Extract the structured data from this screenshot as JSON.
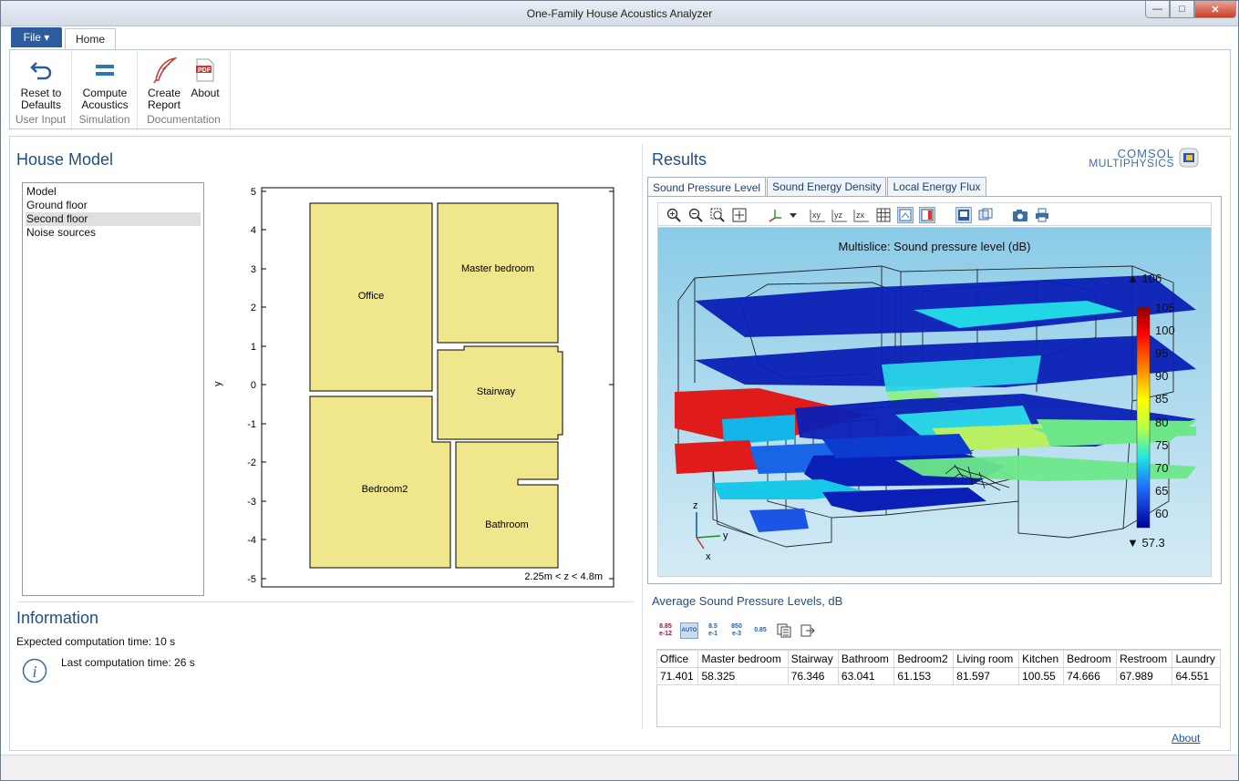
{
  "window": {
    "title": "One-Family House Acoustics Analyzer"
  },
  "ribbon": {
    "file_label": "File ▾",
    "home_label": "Home",
    "groups": [
      {
        "label": "User Input",
        "buttons": [
          {
            "label1": "Reset to",
            "label2": "Defaults",
            "icon": "undo-arrow-icon"
          }
        ]
      },
      {
        "label": "Simulation",
        "buttons": [
          {
            "label1": "Compute",
            "label2": "Acoustics",
            "icon": "equals-icon"
          }
        ]
      },
      {
        "label": "Documentation",
        "buttons": [
          {
            "label1": "Create",
            "label2": "Report",
            "icon": "quill-icon"
          },
          {
            "label1": "About",
            "label2": "",
            "icon": "pdf-icon"
          }
        ]
      }
    ]
  },
  "house_model": {
    "title": "House Model",
    "tree": [
      "Model",
      "Ground floor",
      "Second floor",
      "Noise sources"
    ],
    "selected_index": 2,
    "plot": {
      "y_label": "y",
      "y_ticks": [
        "5",
        "4",
        "3",
        "2",
        "1",
        "0",
        "-1",
        "-2",
        "-3",
        "-4",
        "-5"
      ],
      "rooms": [
        "Office",
        "Master bedroom",
        "Stairway",
        "Bedroom2",
        "Bathroom"
      ],
      "annotation": "2.25m < z < 4.8m",
      "room_color": "#f0e68c"
    }
  },
  "information": {
    "title": "Information",
    "expected": "Expected computation time: 10 s",
    "last": "Last computation time: 26 s",
    "icon": "info-icon"
  },
  "results": {
    "title": "Results",
    "logo_line1": "COMSOL",
    "logo_line2": "MULTIPHYSICS",
    "tabs": [
      "Sound Pressure Level",
      "Sound Energy Density",
      "Local Energy Flux"
    ],
    "active_tab": 0,
    "graphics": {
      "plot_title": "Multislice: Sound pressure level (dB)",
      "max_label": "▲ 106",
      "min_label": "▼ 57.3",
      "colorbar_ticks": [
        "105",
        "100",
        "95",
        "90",
        "85",
        "80",
        "75",
        "70",
        "65",
        "60"
      ],
      "axis_z": "z",
      "axis_y": "y",
      "axis_x": "x"
    }
  },
  "averages": {
    "title": "Average Sound Pressure Levels, dB",
    "toolbar": [
      "8.85\ne-12",
      "AUTO",
      "8.5\ne-1",
      "850\ne-3",
      "0.85"
    ],
    "columns": [
      "Office",
      "Master bedroom",
      "Stairway",
      "Bathroom",
      "Bedroom2",
      "Living room",
      "Kitchen",
      "Bedroom",
      "Restroom",
      "Laundry"
    ],
    "values": [
      "71.401",
      "58.325",
      "76.346",
      "63.041",
      "61.153",
      "81.597",
      "100.55",
      "74.666",
      "67.989",
      "64.551"
    ]
  },
  "footer": {
    "about_link": "About"
  }
}
